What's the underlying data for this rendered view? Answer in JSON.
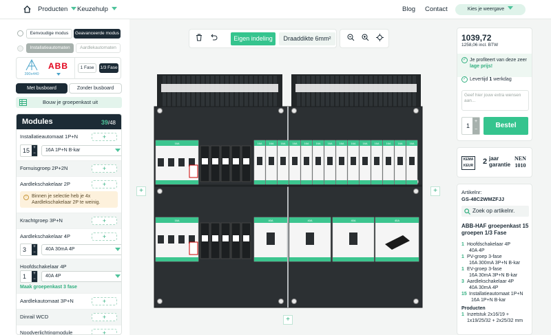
{
  "nav": {
    "products": "Producten",
    "help": "Keuzehulp",
    "blog": "Blog",
    "contact": "Contact",
    "view": "Kies je weergave"
  },
  "mode": {
    "simple": "Eenvoudige modus",
    "advanced": "Geavanceerde modus"
  },
  "type": {
    "install": "Installatieautomaten",
    "aardlek": "Aardlekautomaten"
  },
  "brand": {
    "size": "390x440",
    "abb": "ABB"
  },
  "fase": {
    "one": "1 Fase",
    "three": "1/3 Fase"
  },
  "busbar": {
    "with": "Met busboard",
    "without": "Zonder busboard"
  },
  "build": "Bouw je groepenkast uit",
  "modules": {
    "title": "Modules",
    "count": "39",
    "max": "/48"
  },
  "module_list": [
    {
      "name": "Installatieautomaat 1P+N",
      "qty": "15",
      "value": "16A 1P+N B-kar"
    },
    {
      "name": "Fornuisgroep 2P+2N"
    },
    {
      "name": "Aardlekschakelaar 2P",
      "warning": "Binnen je selectie heb je 4x Aardlekschakelaar 2P te weinig."
    },
    {
      "name": "Krachtgroep 3P+N"
    },
    {
      "name": "Aardlekschakelaar 4P",
      "qty": "3",
      "value": "40A 30mA 4P"
    },
    {
      "name": "Hoofdschakelaar 4P",
      "qty": "1",
      "value": "40A 4P",
      "link": "Maak groepenkast 3 fase"
    },
    {
      "name": "Aardlekautomaat 3P+N"
    },
    {
      "name": "Dinrail WCD"
    },
    {
      "name": "Noodverlichtingmodule"
    }
  ],
  "toolbar": {
    "custom": "Eigen indeling",
    "wire": "Draaddikte 6mm²"
  },
  "side_plus": "+",
  "price": {
    "amount": "1039,72",
    "incl": "1258,06 incl. BTW"
  },
  "benefits": {
    "profit": "Je profiteert van deze zeer",
    "low": "lage prijs!",
    "delivery_pre": "Levertijd ",
    "delivery_days": "1",
    "delivery_post": " werkdag"
  },
  "wishes": "Geef hier jouw extra wensen aan...",
  "order": {
    "qty": "1",
    "label": "Bestel"
  },
  "guarantee": {
    "keur": "KEMA KEUR",
    "years": "2",
    "jaar": "jaar",
    "garantie": "garantie",
    "nen": "NEN",
    "nen_num": "1010"
  },
  "article": {
    "label": "Artikelnr:",
    "code": "GS-48C2WMZFJJ",
    "search": "Zoek op artikelnr."
  },
  "product": {
    "title": "ABB-HAF groepenkast 15 groepen 1/3 Fase"
  },
  "spec": [
    {
      "n": "1",
      "t": "Hoofdschakelaar 4P",
      "s": "40A 4P"
    },
    {
      "n": "1",
      "t": "PV-groep 3-fase",
      "s": "16A 300mA 3P+N B-kar"
    },
    {
      "n": "1",
      "t": "EV-groep 3-fase",
      "s": "16A 30mA 3P+N B-kar"
    },
    {
      "n": "3",
      "t": "Aardlekschakelaar 4P",
      "s": "40A 30mA 4P"
    },
    {
      "n": "15",
      "t": "Installatieautomaat 1P+N",
      "s": "16A 1P+N B-kar"
    }
  ],
  "products_head": "Producten",
  "products": [
    {
      "n": "1",
      "t": "Inzetstuk 2x16/19 + 1x19/25/32 + 2x25/32 mm"
    }
  ],
  "breaker_labels": {
    "r16": "16A",
    "r40": "40A"
  },
  "colors": {
    "accent": "#35c48e",
    "dark": "#1c2b36",
    "panel": "#2c3033"
  }
}
